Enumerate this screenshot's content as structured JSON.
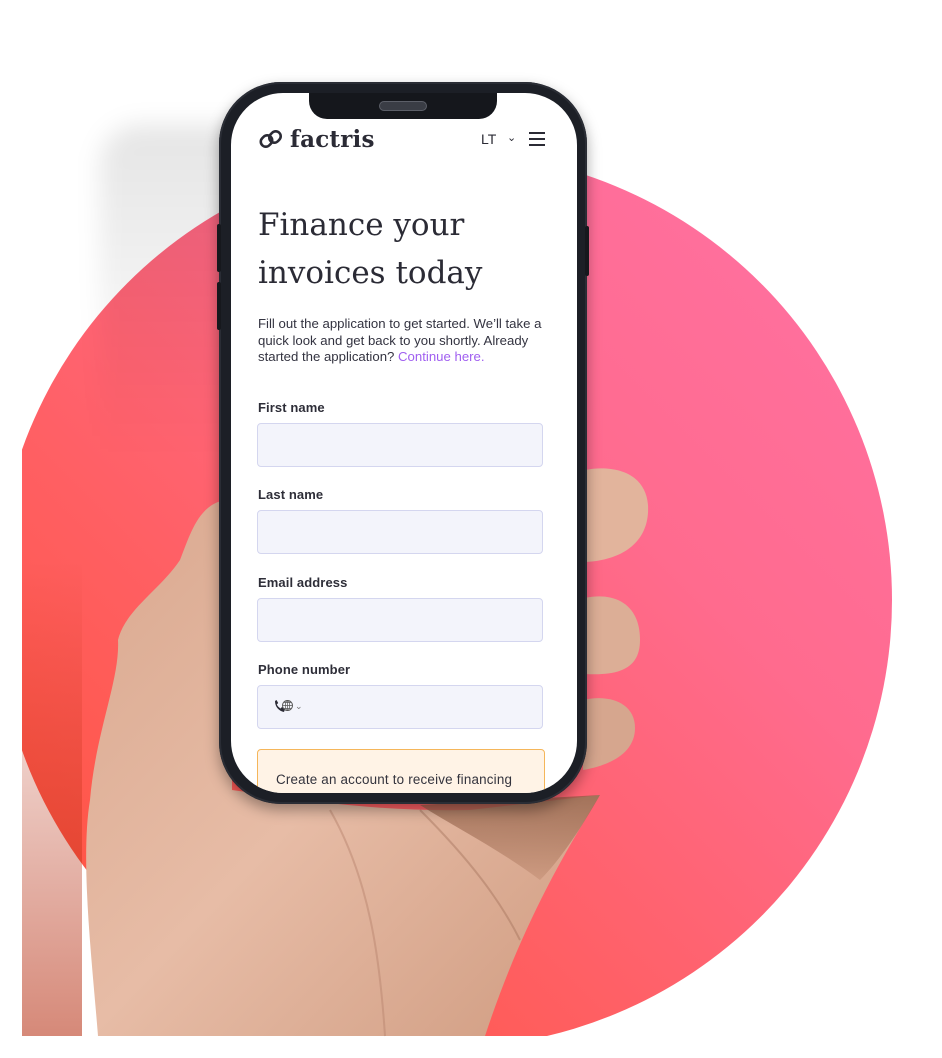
{
  "colors": {
    "disc_gradient": [
      "#ff72a6",
      "#ff5136"
    ],
    "link": "#a05ff0",
    "field_border": "#d4d6ef",
    "field_bg": "#f3f4fb",
    "notice_border": "#f5b65a",
    "notice_bg": "#fff3e6",
    "text": "#2b2b35"
  },
  "header": {
    "brand": "factris",
    "logo_icon": "factris-logo-icon",
    "language": "LT",
    "language_chevron": "⌄",
    "menu_icon": "hamburger-menu-icon"
  },
  "hero": {
    "title_line1": "Finance your",
    "title_line2": "invoices today",
    "intro": "Fill out the application to get started. We’ll take a quick look and get back to you shortly. Already started the application? ",
    "continue_link": "Continue here."
  },
  "form": {
    "fields": [
      {
        "label": "First name",
        "value": "",
        "placeholder": ""
      },
      {
        "label": "Last name",
        "value": "",
        "placeholder": ""
      },
      {
        "label": "Email address",
        "value": "",
        "placeholder": ""
      },
      {
        "label": "Phone number",
        "value": "",
        "placeholder": "",
        "prefix_icon": "phone-globe-icon"
      }
    ],
    "notice": "Create an account to receive financing"
  }
}
